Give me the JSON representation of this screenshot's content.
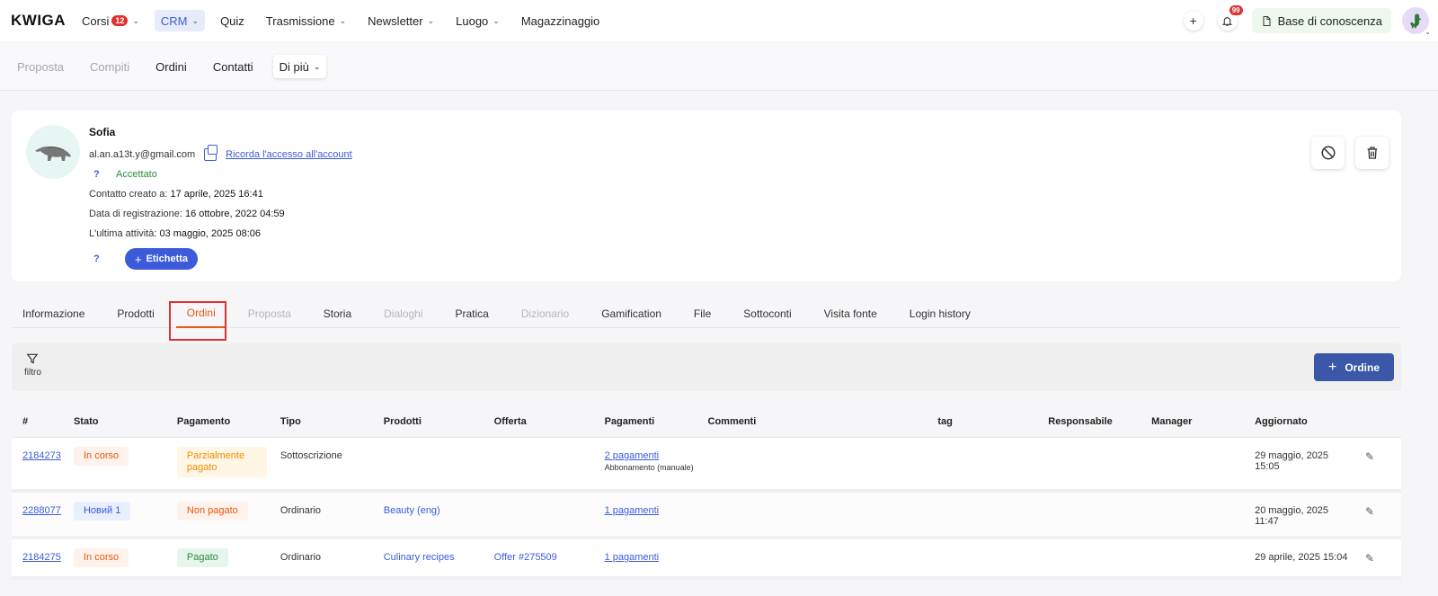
{
  "topnav": {
    "logo": "KWIGA",
    "items": [
      {
        "label": "Corsi",
        "badge": "12",
        "dropdown": true
      },
      {
        "label": "CRM",
        "dropdown": true,
        "active": true
      },
      {
        "label": "Quiz"
      },
      {
        "label": "Trasmissione",
        "dropdown": true
      },
      {
        "label": "Newsletter",
        "dropdown": true
      },
      {
        "label": "Luogo",
        "dropdown": true
      },
      {
        "label": "Magazzinaggio"
      }
    ],
    "plus_label": "+",
    "notifications_badge": "99",
    "knowledge_base_label": "Base di conoscenza"
  },
  "subnav": {
    "items": [
      "Proposta",
      "Compiti",
      "Ordini",
      "Contatti"
    ],
    "more_label": "Di più"
  },
  "contact": {
    "name": "Sofia",
    "email": "al.an.a13t.y@gmail.com",
    "remember_access_link": "Ricorda l'accesso all'account",
    "help_mark": "?",
    "status": "Accettato",
    "created_label": "Contatto creato a:",
    "created_value": "17 aprile, 2025 16:41",
    "registered_label": "Data di registrazione:",
    "registered_value": "16 ottobre, 2022 04:59",
    "last_activity_label": "L'ultima attività:",
    "last_activity_value": "03 maggio, 2025 08:06",
    "tag_button_label": "Etichetta"
  },
  "tabs": [
    {
      "label": "Informazione"
    },
    {
      "label": "Prodotti"
    },
    {
      "label": "Ordini",
      "active": true
    },
    {
      "label": "Proposta",
      "muted": true
    },
    {
      "label": "Storia"
    },
    {
      "label": "Dialoghi",
      "muted": true
    },
    {
      "label": "Pratica"
    },
    {
      "label": "Dizionario",
      "muted": true
    },
    {
      "label": "Gamification"
    },
    {
      "label": "File"
    },
    {
      "label": "Sottoconti"
    },
    {
      "label": "Visita fonte"
    },
    {
      "label": "Login history"
    }
  ],
  "filterbar": {
    "filter_label": "filtro",
    "order_button_label": "Ordine"
  },
  "orders_table": {
    "columns": [
      "#",
      "Stato",
      "Pagamento",
      "Tipo",
      "Prodotti",
      "Offerta",
      "Pagamenti",
      "Commenti",
      "tag",
      "Responsabile",
      "Manager",
      "Aggiornato"
    ],
    "rows": [
      {
        "id": "2184273",
        "status": "In corso",
        "payment": "Parzialmente pagato",
        "type": "Sottoscrizione",
        "product": "",
        "offer": "",
        "payments": "2 pagamenti",
        "payments_note": "Abbonamento (manuale)",
        "updated_date": "29 maggio, 2025",
        "updated_time": "15:05"
      },
      {
        "id": "2288077",
        "status": "Новий 1",
        "payment": "Non pagato",
        "type": "Ordinario",
        "product": "Beauty (eng)",
        "offer": "",
        "payments": "1 pagamenti",
        "payments_note": "",
        "updated_date": "20 maggio, 2025",
        "updated_time": "11:47"
      },
      {
        "id": "2184275",
        "status": "In corso",
        "payment": "Pagato",
        "type": "Ordinario",
        "product": "Culinary recipes",
        "offer": "Offer #275509",
        "payments": "1 pagamenti",
        "payments_note": "",
        "updated_date": "29 aprile, 2025 15:04",
        "updated_time": ""
      }
    ]
  },
  "colors": {
    "accent": "#3b5bdb",
    "active_tab": "#e8590c",
    "highlight": "#e03131",
    "order_button": "#3b57a8"
  }
}
